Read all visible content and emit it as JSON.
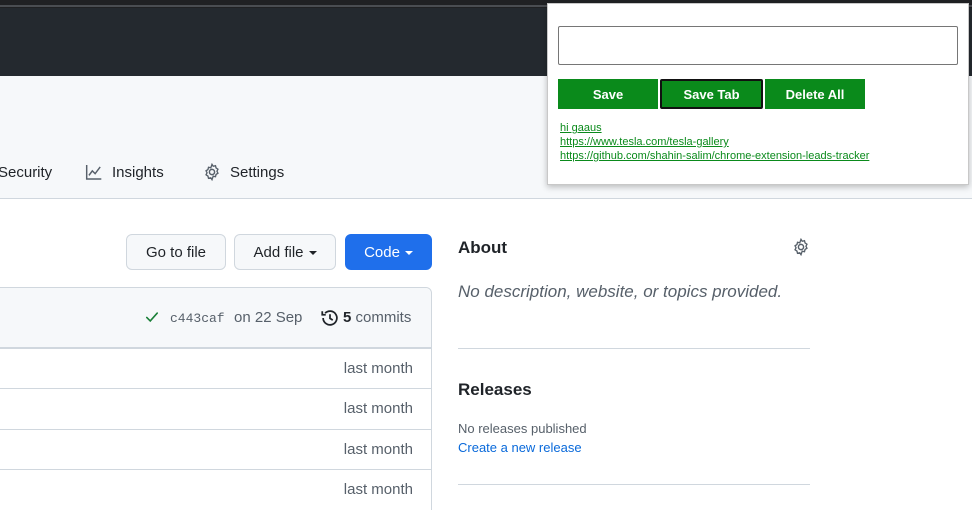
{
  "repo_nav": {
    "tabs": [
      {
        "label": "Security",
        "icon": "shield-icon"
      },
      {
        "label": "Insights",
        "icon": "graph-icon"
      },
      {
        "label": "Settings",
        "icon": "gear-icon"
      }
    ]
  },
  "actions": {
    "go_to_file": "Go to file",
    "add_file": "Add file",
    "code": "Code"
  },
  "commit": {
    "sha": "c443caf",
    "date": "on 22 Sep",
    "count": "5",
    "count_label": "commits"
  },
  "files": [
    {
      "updated": "last month"
    },
    {
      "updated": "last month"
    },
    {
      "updated": "last month"
    },
    {
      "updated": "last month"
    }
  ],
  "about": {
    "title": "About",
    "description": "No description, website, or topics provided."
  },
  "releases": {
    "title": "Releases",
    "none_text": "No releases published",
    "create_link": "Create a new release"
  },
  "popup": {
    "input_value": "",
    "save_label": "Save",
    "save_tab_label": "Save Tab",
    "delete_all_label": "Delete All",
    "leads": [
      "hi gaaus",
      "https://www.tesla.com/tesla-gallery",
      "https://github.com/shahin-salim/chrome-extension-leads-tracker"
    ],
    "accent": "#0a8a1b"
  },
  "colors": {
    "header_bg": "#24292f",
    "primary_button": "#1f6feb",
    "link": "#0969da"
  }
}
